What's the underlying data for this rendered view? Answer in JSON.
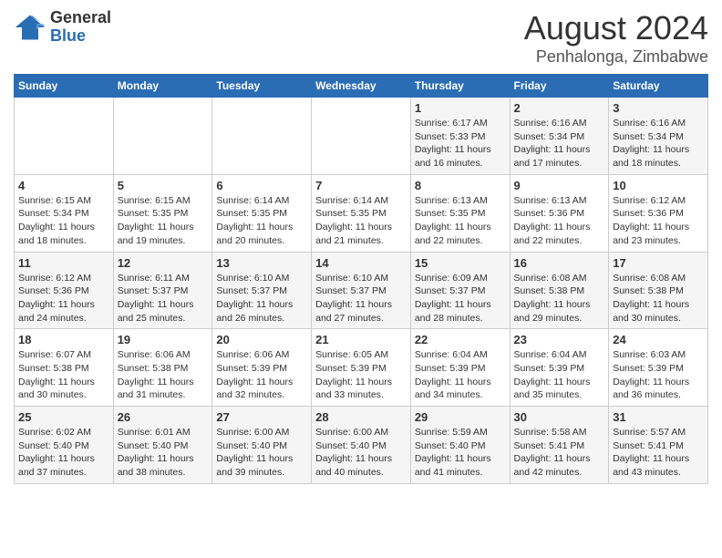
{
  "logo": {
    "general": "General",
    "blue": "Blue"
  },
  "title": "August 2024",
  "subtitle": "Penhalonga, Zimbabwe",
  "weekdays": [
    "Sunday",
    "Monday",
    "Tuesday",
    "Wednesday",
    "Thursday",
    "Friday",
    "Saturday"
  ],
  "weeks": [
    [
      {
        "day": "",
        "info": ""
      },
      {
        "day": "",
        "info": ""
      },
      {
        "day": "",
        "info": ""
      },
      {
        "day": "",
        "info": ""
      },
      {
        "day": "1",
        "info": "Sunrise: 6:17 AM\nSunset: 5:33 PM\nDaylight: 11 hours\nand 16 minutes."
      },
      {
        "day": "2",
        "info": "Sunrise: 6:16 AM\nSunset: 5:34 PM\nDaylight: 11 hours\nand 17 minutes."
      },
      {
        "day": "3",
        "info": "Sunrise: 6:16 AM\nSunset: 5:34 PM\nDaylight: 11 hours\nand 18 minutes."
      }
    ],
    [
      {
        "day": "4",
        "info": "Sunrise: 6:15 AM\nSunset: 5:34 PM\nDaylight: 11 hours\nand 18 minutes."
      },
      {
        "day": "5",
        "info": "Sunrise: 6:15 AM\nSunset: 5:35 PM\nDaylight: 11 hours\nand 19 minutes."
      },
      {
        "day": "6",
        "info": "Sunrise: 6:14 AM\nSunset: 5:35 PM\nDaylight: 11 hours\nand 20 minutes."
      },
      {
        "day": "7",
        "info": "Sunrise: 6:14 AM\nSunset: 5:35 PM\nDaylight: 11 hours\nand 21 minutes."
      },
      {
        "day": "8",
        "info": "Sunrise: 6:13 AM\nSunset: 5:35 PM\nDaylight: 11 hours\nand 22 minutes."
      },
      {
        "day": "9",
        "info": "Sunrise: 6:13 AM\nSunset: 5:36 PM\nDaylight: 11 hours\nand 22 minutes."
      },
      {
        "day": "10",
        "info": "Sunrise: 6:12 AM\nSunset: 5:36 PM\nDaylight: 11 hours\nand 23 minutes."
      }
    ],
    [
      {
        "day": "11",
        "info": "Sunrise: 6:12 AM\nSunset: 5:36 PM\nDaylight: 11 hours\nand 24 minutes."
      },
      {
        "day": "12",
        "info": "Sunrise: 6:11 AM\nSunset: 5:37 PM\nDaylight: 11 hours\nand 25 minutes."
      },
      {
        "day": "13",
        "info": "Sunrise: 6:10 AM\nSunset: 5:37 PM\nDaylight: 11 hours\nand 26 minutes."
      },
      {
        "day": "14",
        "info": "Sunrise: 6:10 AM\nSunset: 5:37 PM\nDaylight: 11 hours\nand 27 minutes."
      },
      {
        "day": "15",
        "info": "Sunrise: 6:09 AM\nSunset: 5:37 PM\nDaylight: 11 hours\nand 28 minutes."
      },
      {
        "day": "16",
        "info": "Sunrise: 6:08 AM\nSunset: 5:38 PM\nDaylight: 11 hours\nand 29 minutes."
      },
      {
        "day": "17",
        "info": "Sunrise: 6:08 AM\nSunset: 5:38 PM\nDaylight: 11 hours\nand 30 minutes."
      }
    ],
    [
      {
        "day": "18",
        "info": "Sunrise: 6:07 AM\nSunset: 5:38 PM\nDaylight: 11 hours\nand 30 minutes."
      },
      {
        "day": "19",
        "info": "Sunrise: 6:06 AM\nSunset: 5:38 PM\nDaylight: 11 hours\nand 31 minutes."
      },
      {
        "day": "20",
        "info": "Sunrise: 6:06 AM\nSunset: 5:39 PM\nDaylight: 11 hours\nand 32 minutes."
      },
      {
        "day": "21",
        "info": "Sunrise: 6:05 AM\nSunset: 5:39 PM\nDaylight: 11 hours\nand 33 minutes."
      },
      {
        "day": "22",
        "info": "Sunrise: 6:04 AM\nSunset: 5:39 PM\nDaylight: 11 hours\nand 34 minutes."
      },
      {
        "day": "23",
        "info": "Sunrise: 6:04 AM\nSunset: 5:39 PM\nDaylight: 11 hours\nand 35 minutes."
      },
      {
        "day": "24",
        "info": "Sunrise: 6:03 AM\nSunset: 5:39 PM\nDaylight: 11 hours\nand 36 minutes."
      }
    ],
    [
      {
        "day": "25",
        "info": "Sunrise: 6:02 AM\nSunset: 5:40 PM\nDaylight: 11 hours\nand 37 minutes."
      },
      {
        "day": "26",
        "info": "Sunrise: 6:01 AM\nSunset: 5:40 PM\nDaylight: 11 hours\nand 38 minutes."
      },
      {
        "day": "27",
        "info": "Sunrise: 6:00 AM\nSunset: 5:40 PM\nDaylight: 11 hours\nand 39 minutes."
      },
      {
        "day": "28",
        "info": "Sunrise: 6:00 AM\nSunset: 5:40 PM\nDaylight: 11 hours\nand 40 minutes."
      },
      {
        "day": "29",
        "info": "Sunrise: 5:59 AM\nSunset: 5:40 PM\nDaylight: 11 hours\nand 41 minutes."
      },
      {
        "day": "30",
        "info": "Sunrise: 5:58 AM\nSunset: 5:41 PM\nDaylight: 11 hours\nand 42 minutes."
      },
      {
        "day": "31",
        "info": "Sunrise: 5:57 AM\nSunset: 5:41 PM\nDaylight: 11 hours\nand 43 minutes."
      }
    ]
  ]
}
